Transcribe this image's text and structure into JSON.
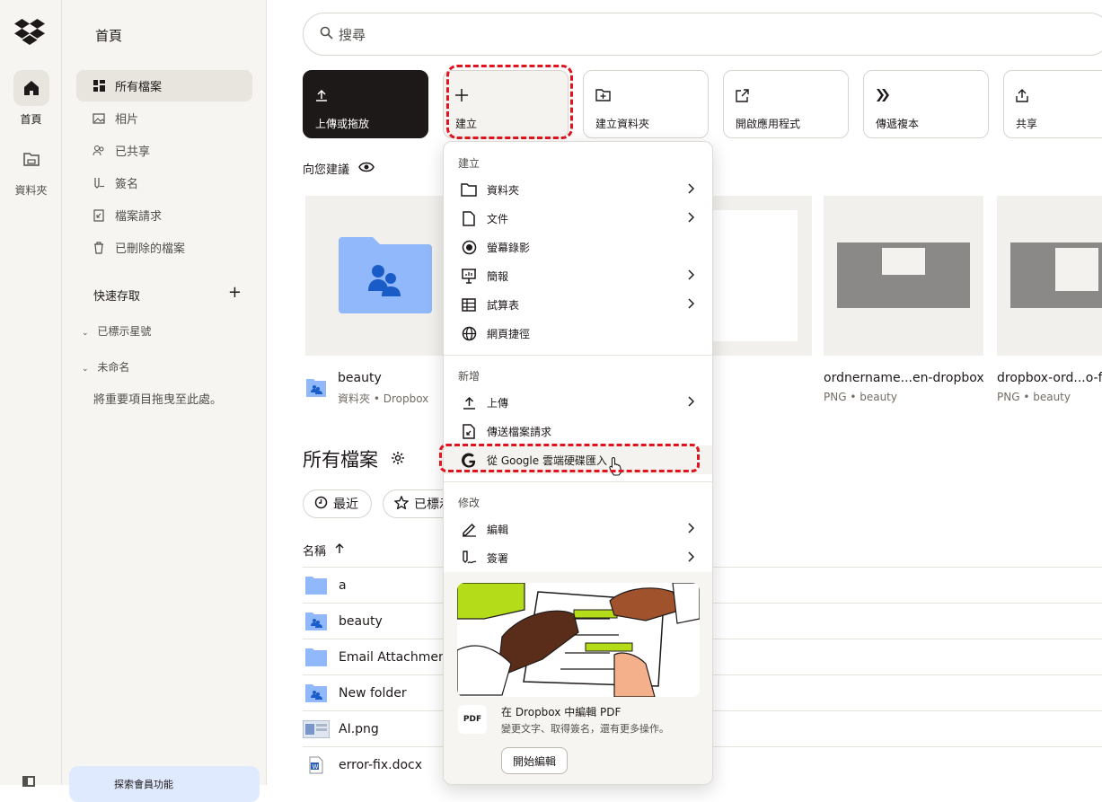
{
  "rail": {
    "items": [
      {
        "label": "首頁",
        "icon": "home-icon"
      },
      {
        "label": "資料夾",
        "icon": "folder-icon"
      }
    ]
  },
  "sidebar": {
    "title": "首頁",
    "items": [
      {
        "label": "所有檔案",
        "icon": "all-files-icon"
      },
      {
        "label": "相片",
        "icon": "photos-icon"
      },
      {
        "label": "已共享",
        "icon": "shared-icon"
      },
      {
        "label": "簽名",
        "icon": "signature-icon"
      },
      {
        "label": "檔案請求",
        "icon": "file-request-icon"
      },
      {
        "label": "已刪除的檔案",
        "icon": "trash-icon"
      }
    ],
    "quick_access": "快速存取",
    "quick_access_add": "+",
    "starred": "已標示星號",
    "untitled": "未命名",
    "drag_hint": "將重要項目拖曳至此處。",
    "promo": "探索會員功能"
  },
  "search": {
    "placeholder": "搜尋"
  },
  "actions": [
    {
      "label": "上傳或拖放",
      "icon": "upload-icon"
    },
    {
      "label": "建立",
      "icon": "plus-icon"
    },
    {
      "label": "建立資料夾",
      "icon": "new-folder-icon"
    },
    {
      "label": "開啟應用程式",
      "icon": "open-app-icon"
    },
    {
      "label": "傳遞複本",
      "icon": "transfer-icon"
    },
    {
      "label": "共享",
      "icon": "share-icon"
    }
  ],
  "suggested": {
    "title": "向您建議",
    "cards": [
      {
        "name": "beauty",
        "sub": "資料夾 • Dropbox"
      },
      {
        "name": "ordnername...en-dropbox",
        "sub": "PNG • beauty"
      },
      {
        "name": "dropbox-ord...o-fre",
        "sub": "PNG • beauty"
      }
    ]
  },
  "all_files": {
    "title": "所有檔案",
    "filters": [
      "最近",
      "已標示"
    ],
    "column_name": "名稱",
    "rows": [
      {
        "name": "a",
        "icon": "folder-icon"
      },
      {
        "name": "beauty",
        "icon": "shared-folder-icon"
      },
      {
        "name": "Email Attachmen",
        "icon": "folder-icon"
      },
      {
        "name": "New folder",
        "icon": "shared-folder-icon"
      },
      {
        "name": "AI.png",
        "icon": "image-thumb-icon"
      },
      {
        "name": "error-fix.docx",
        "icon": "word-doc-icon"
      }
    ]
  },
  "create_menu": {
    "create_header": "建立",
    "create_items": [
      {
        "label": "資料夾",
        "icon": "folder-outline-icon",
        "submenu": true
      },
      {
        "label": "文件",
        "icon": "document-icon",
        "submenu": true
      },
      {
        "label": "螢幕錄影",
        "icon": "record-icon",
        "submenu": false
      },
      {
        "label": "簡報",
        "icon": "presentation-icon",
        "submenu": true
      },
      {
        "label": "試算表",
        "icon": "spreadsheet-icon",
        "submenu": true
      },
      {
        "label": "網頁捷徑",
        "icon": "globe-icon",
        "submenu": false
      }
    ],
    "add_header": "新增",
    "add_items": [
      {
        "label": "上傳",
        "icon": "upload-icon",
        "submenu": true
      },
      {
        "label": "傳送檔案請求",
        "icon": "file-request-icon",
        "submenu": false
      },
      {
        "label": "從 Google 雲端硬碟匯入",
        "icon": "google-icon",
        "submenu": false
      }
    ],
    "edit_header": "修改",
    "edit_items": [
      {
        "label": "編輯",
        "icon": "pen-icon",
        "submenu": true
      },
      {
        "label": "簽署",
        "icon": "sign-icon",
        "submenu": true
      }
    ],
    "promo": {
      "badge": "PDF",
      "title": "在 Dropbox 中編輯 PDF",
      "subtitle": "變更文字、取得簽名，還有更多操作。",
      "button": "開始編輯"
    }
  },
  "colors": {
    "accent_dark": "#1e1919",
    "highlight_dash": "#e0141e",
    "folder_blue": "#91b8fa",
    "sidebar_bg": "#f7f5f2"
  }
}
